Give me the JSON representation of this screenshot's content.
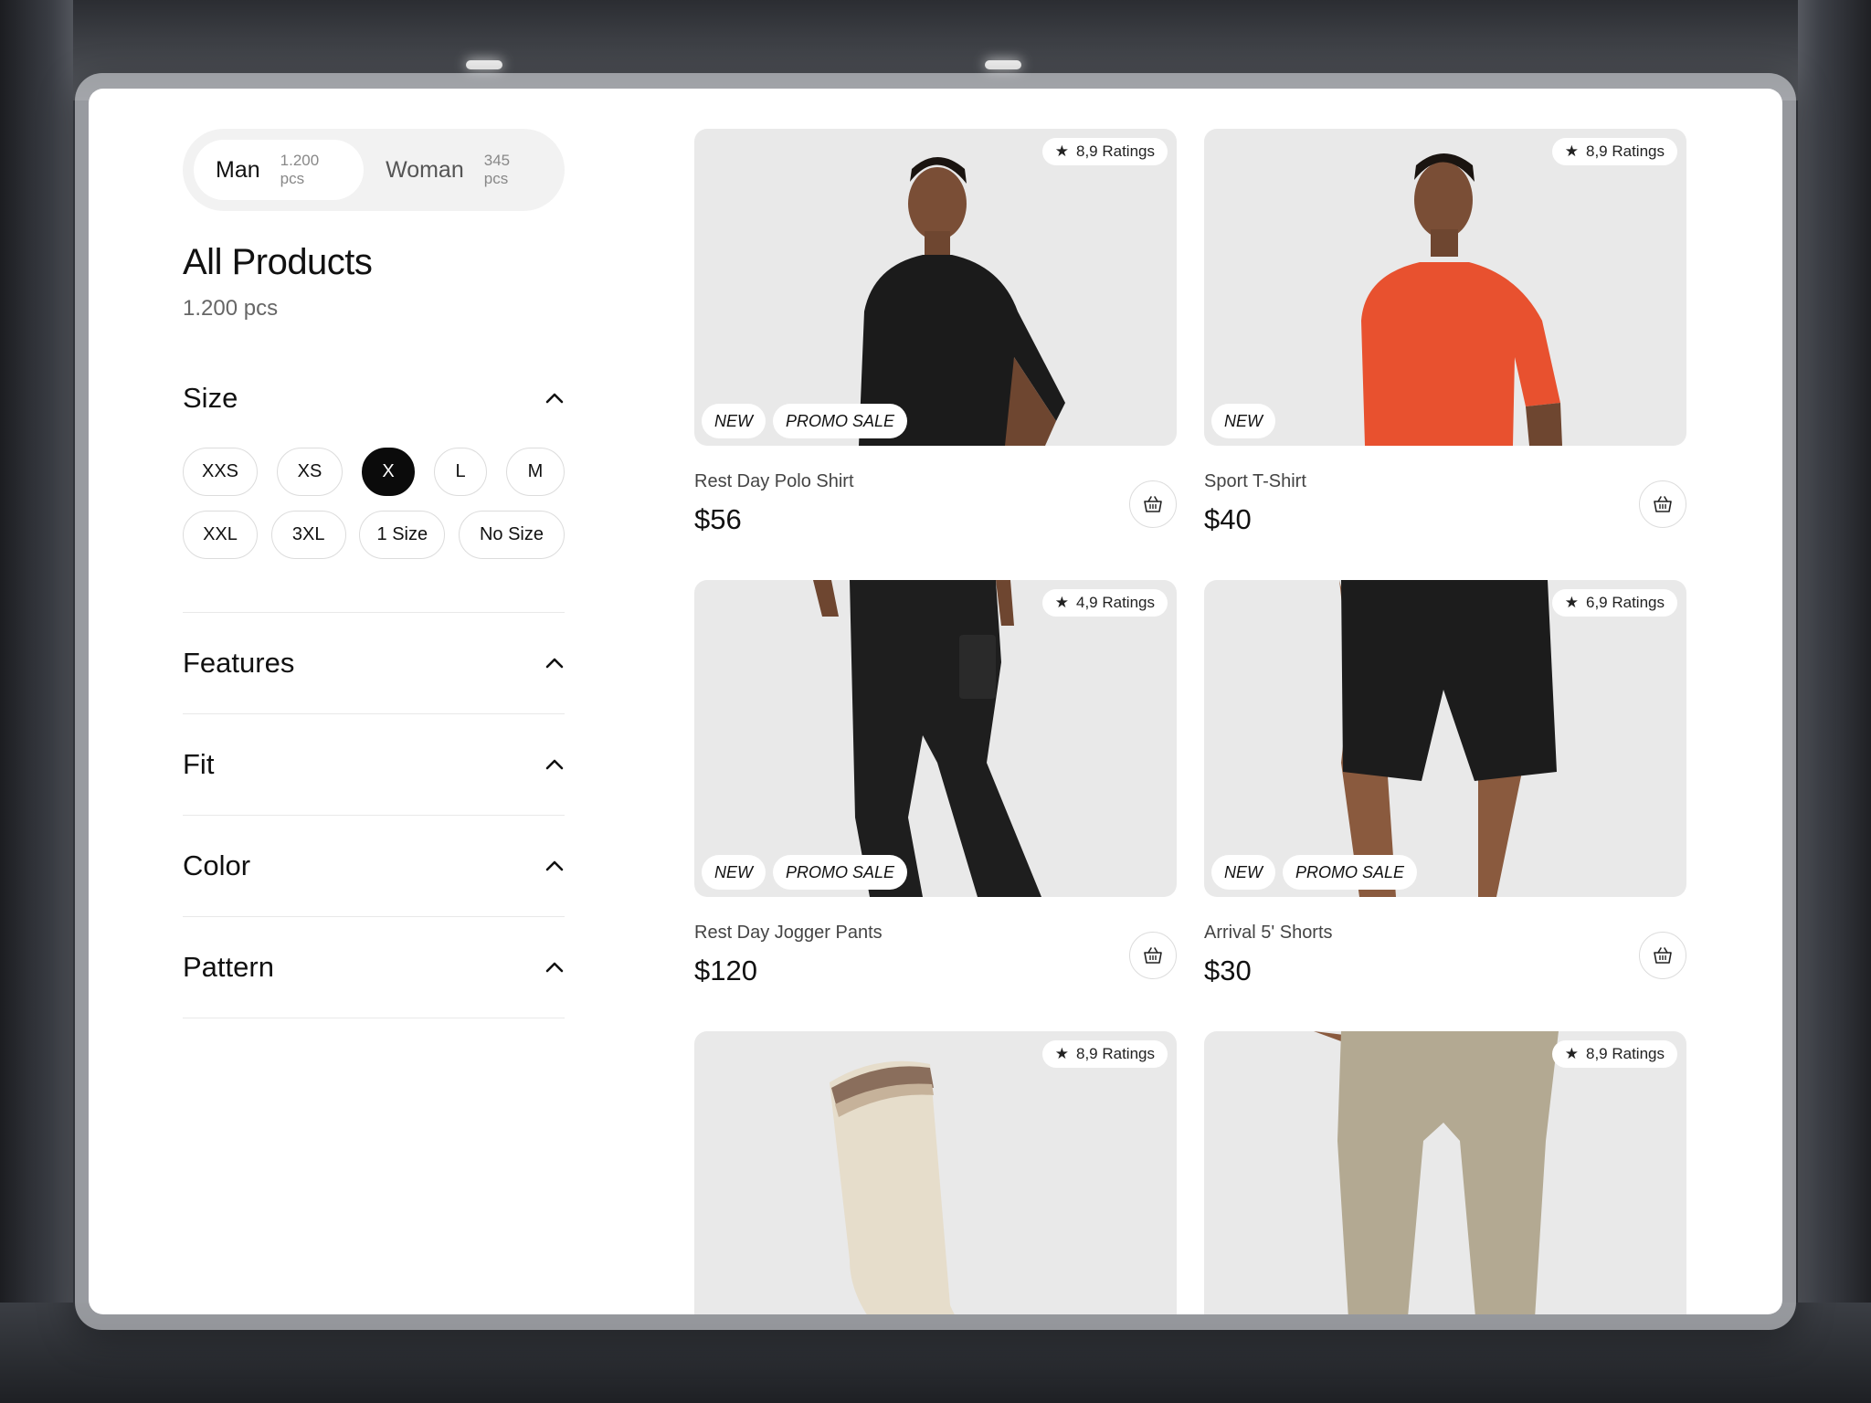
{
  "gender": [
    {
      "name": "Man",
      "count": "1.200 pcs",
      "active": true
    },
    {
      "name": "Woman",
      "count": "345 pcs",
      "active": false
    }
  ],
  "page": {
    "title": "All Products",
    "count": "1.200 pcs"
  },
  "filters": {
    "size": {
      "title": "Size",
      "options": [
        "XXS",
        "XS",
        "X",
        "L",
        "M",
        "XXL",
        "3XL",
        "1 Size",
        "No Size"
      ],
      "selected": "X"
    },
    "features": {
      "title": "Features"
    },
    "fit": {
      "title": "Fit"
    },
    "color": {
      "title": "Color"
    },
    "pattern": {
      "title": "Pattern"
    }
  },
  "products": [
    {
      "name": "Rest Day Polo Shirt",
      "price": "$56",
      "rating": "8,9 Ratings",
      "tags": [
        "NEW",
        "PROMO SALE"
      ],
      "image": "black-polo-shirt"
    },
    {
      "name": "Sport T-Shirt",
      "price": "$40",
      "rating": "8,9 Ratings",
      "tags": [
        "NEW"
      ],
      "image": "orange-t-shirt"
    },
    {
      "name": "Rest Day Jogger Pants",
      "price": "$120",
      "rating": "4,9 Ratings",
      "tags": [
        "NEW",
        "PROMO SALE"
      ],
      "image": "black-jogger-pants"
    },
    {
      "name": "Arrival 5' Shorts",
      "price": "$30",
      "rating": "6,9 Ratings",
      "tags": [
        "NEW",
        "PROMO SALE"
      ],
      "image": "black-shorts"
    },
    {
      "name": "",
      "price": "",
      "rating": "8,9 Ratings",
      "tags": [],
      "image": "cream-sock"
    },
    {
      "name": "",
      "price": "",
      "rating": "8,9 Ratings",
      "tags": [],
      "image": "khaki-pants"
    }
  ],
  "icons": {
    "rating": "star-icon",
    "cart": "basket-icon",
    "collapse": "chevron-up-icon"
  },
  "colors": {
    "accent": "#0b0b0b",
    "card_bg": "#e9e9e9",
    "orange_shirt": "#e8512f",
    "khaki": "#b3a992"
  }
}
